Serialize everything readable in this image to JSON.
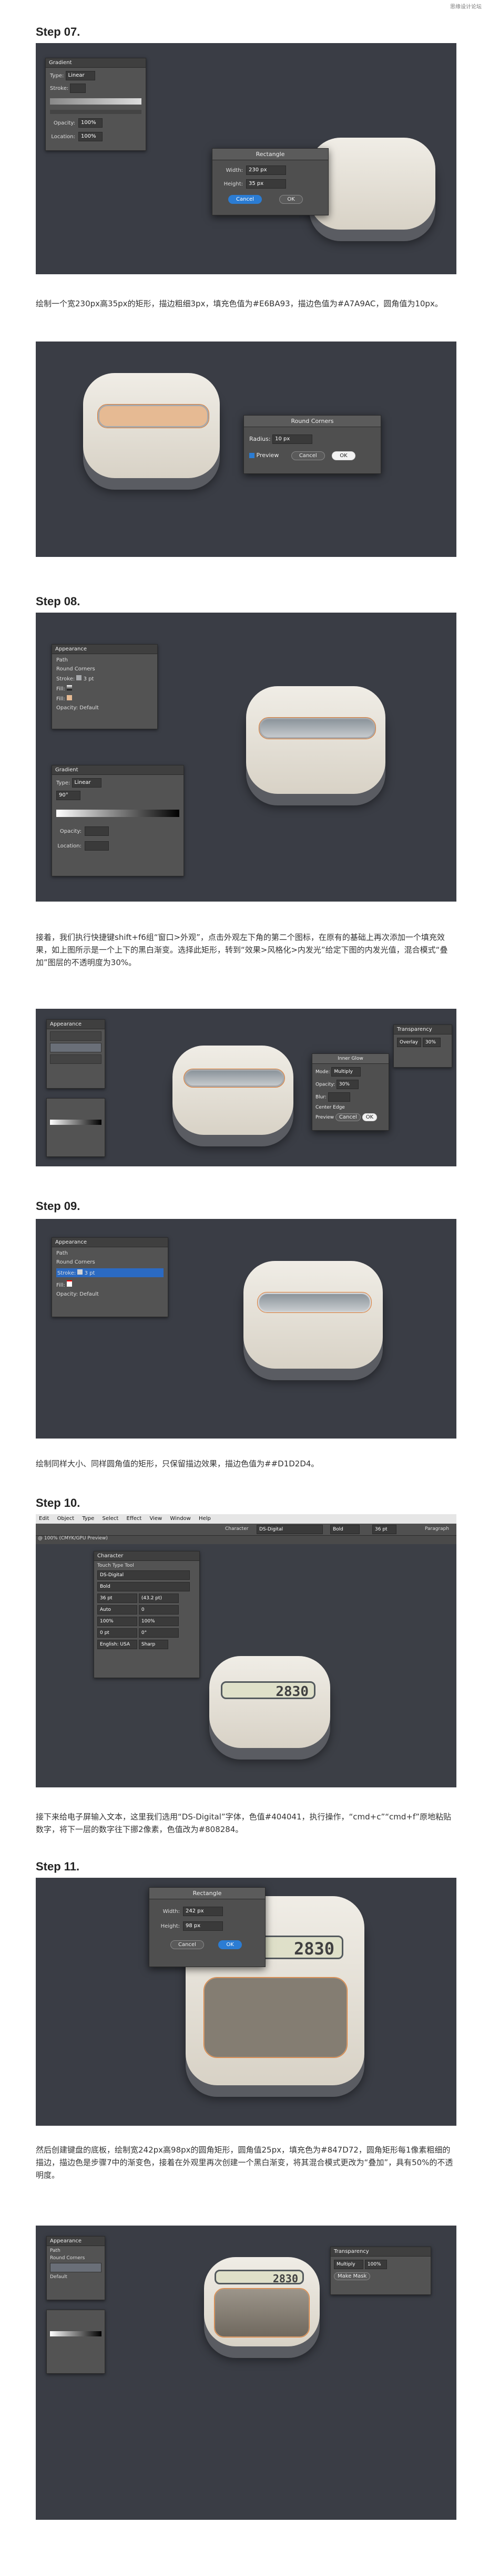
{
  "watermark": "思缘设计论坛",
  "steps": [
    {
      "title": "Step 07."
    },
    {
      "title": "Step 08."
    },
    {
      "title": "Step 09."
    },
    {
      "title": "Step 10."
    },
    {
      "title": "Step 11."
    }
  ],
  "paragraphs": {
    "p7": "绘制一个宽230px高35px的矩形，描边粗细3px，填充色值为#E6BA93，描边色值为#A7A9AC，圆角值为10px。",
    "p8": "接着，我们执行快捷键shift+f6组“窗口>外观”，点击外观左下角的第二个图标，在原有的基础上再次添加一个填充效果，如上图所示是一个上下的黑白渐变。选择此矩形，转到“效果>风格化>内发光”给定下图的内发光值，混合模式“叠加”图层的不透明度为30%。",
    "p9": "绘制同样大小、同样圆角值的矩形，只保留描边效果，描边色值为##D1D2D4。",
    "p10": "接下来给电子屏输入文本，这里我们选用“DS-Digital”字体，色值#404041，执行操作，“cmd+c”“cmd+f”原地粘贴数字，将下一层的数字往下挪2像素，色值改为#808284。",
    "p11": "然后创建键盘的底板，绘制宽242px高98px的圆角矩形，圆角值25px，填充色为#847D72，圆角矩形每1像素粗细的描边，描边色是步骤7中的渐变色，接着在外观里再次创建一个黑白渐变，将其混合模式更改为“叠加”，具有50%的不透明度。"
  },
  "s7a": {
    "gradient_panel": {
      "title": "Gradient",
      "type_label": "Type:",
      "type_value": "Linear",
      "stroke_label": "Stroke:",
      "opacity_label": "Opacity:",
      "opacity_value": "100%",
      "location_label": "Location:",
      "location_value": "100%"
    },
    "rect_dialog": {
      "title": "Rectangle",
      "width_label": "Width:",
      "width_value": "230 px",
      "height_label": "Height:",
      "height_value": "35 px",
      "cancel": "Cancel",
      "ok": "OK"
    }
  },
  "s7b": {
    "dialog": {
      "title": "Round Corners",
      "radius_label": "Radius:",
      "radius_value": "10 px",
      "preview": "Preview",
      "cancel": "Cancel",
      "ok": "OK"
    }
  },
  "s8a": {
    "appearance": {
      "title": "Appearance",
      "path": "Path",
      "round_corners": "Round Corners",
      "stroke": "Stroke:",
      "stroke_value": "3 pt",
      "fill1": "Fill:",
      "fill2": "Fill:",
      "opacity": "Opacity:",
      "opacity_value": "Default"
    },
    "gradient": {
      "title": "Gradient",
      "type_label": "Type:",
      "type_value": "Linear",
      "angle_value": "90°",
      "opacity_label": "Opacity:",
      "location_label": "Location:"
    }
  },
  "s8b": {
    "layers_title": "Appearance",
    "inner_glow": {
      "title": "Inner Glow",
      "mode_label": "Mode:",
      "mode_value": "Multiply",
      "opacity_label": "Opacity:",
      "opacity_value": "30%",
      "blur_label": "Blur:",
      "center": "Center",
      "edge": "Edge",
      "preview": "Preview",
      "cancel": "Cancel",
      "ok": "OK"
    },
    "transparency": {
      "title": "Transparency",
      "mode": "Overlay",
      "opacity": "30%"
    }
  },
  "s9": {
    "appearance": {
      "title": "Appearance",
      "path": "Path",
      "round_corners": "Round Corners",
      "stroke": "Stroke:",
      "stroke_value": "3 pt",
      "fill": "Fill:",
      "opacity": "Opacity:",
      "opacity_value": "Default"
    }
  },
  "s10": {
    "menu": [
      "Edit",
      "Object",
      "Type",
      "Select",
      "Effect",
      "View",
      "Window",
      "Help"
    ],
    "control": {
      "character": "Character",
      "font": "DS-Digital",
      "style": "Bold",
      "size": "36 pt",
      "paragraph": "Paragraph"
    },
    "doc_tab": "@ 100% (CMYK/GPU Preview)",
    "char_panel": {
      "title": "Character",
      "font": "DS-Digital",
      "style": "Bold",
      "size": "36 pt",
      "leading": "(43.2 pt)",
      "tracking": "0",
      "kerning": "Auto",
      "scale_h": "100%",
      "scale_v": "100%",
      "baseline": "0 pt",
      "rotation": "0°",
      "language": "English: USA",
      "aa": "Sharp",
      "touch": "Touch Type Tool"
    },
    "lcd_text": "2830"
  },
  "s11a": {
    "dialog": {
      "title": "Rectangle",
      "width_label": "Width:",
      "width_value": "242 px",
      "height_label": "Height:",
      "height_value": "98 px",
      "cancel": "Cancel",
      "ok": "OK"
    },
    "lcd_text": "2830"
  },
  "s11b": {
    "appearance": {
      "title": "Appearance",
      "path": "Path",
      "round_corners": "Round Corners",
      "opacity_value": "Default"
    },
    "transparency": {
      "title": "Transparency",
      "mode": "Multiply",
      "opacity": "100%",
      "make_mask": "Make Mask"
    },
    "lcd_text": "2830"
  }
}
